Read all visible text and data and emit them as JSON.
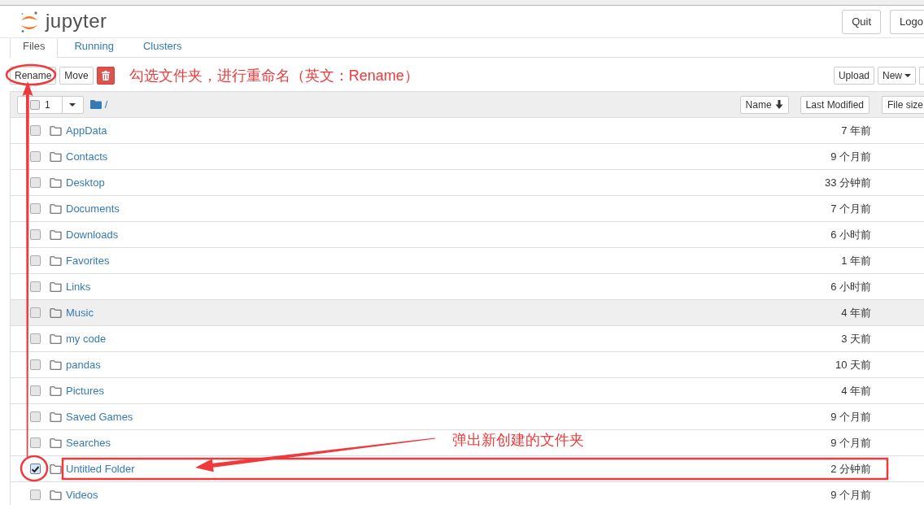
{
  "header": {
    "logo": "jupyter",
    "buttons": [
      "Quit",
      "Logo"
    ]
  },
  "tabs": [
    {
      "label": "Files",
      "selected": true
    },
    {
      "label": "Running",
      "selected": false
    },
    {
      "label": "Clusters",
      "selected": false
    }
  ],
  "toolbar": {
    "left_buttons": [
      "Rename",
      "Move"
    ],
    "note": "勾选文件夹，进行重命名（英文：Rename）",
    "right_buttons": [
      {
        "label": "Upload",
        "dropdown": false
      },
      {
        "label": "New",
        "dropdown": true
      }
    ]
  },
  "list_header": {
    "select_all_checked": false,
    "selected_count": "1",
    "path": "/",
    "sort_buttons": [
      {
        "label": "Name",
        "sorted": true
      },
      {
        "label": "Last Modified",
        "sorted": false
      },
      {
        "label": "File size",
        "sorted": false
      }
    ]
  },
  "files": [
    {
      "name": "AppData",
      "modified": "7 年前",
      "checked": false,
      "highlighted": false
    },
    {
      "name": "Contacts",
      "modified": "9 个月前",
      "checked": false,
      "highlighted": false
    },
    {
      "name": "Desktop",
      "modified": "33 分钟前",
      "checked": false,
      "highlighted": false
    },
    {
      "name": "Documents",
      "modified": "7 个月前",
      "checked": false,
      "highlighted": false
    },
    {
      "name": "Downloads",
      "modified": "6 小时前",
      "checked": false,
      "highlighted": false
    },
    {
      "name": "Favorites",
      "modified": "1 年前",
      "checked": false,
      "highlighted": false
    },
    {
      "name": "Links",
      "modified": "6 小时前",
      "checked": false,
      "highlighted": false
    },
    {
      "name": "Music",
      "modified": "4 年前",
      "checked": false,
      "highlighted": true
    },
    {
      "name": "my code",
      "modified": "3 天前",
      "checked": false,
      "highlighted": false
    },
    {
      "name": "pandas",
      "modified": "10 天前",
      "checked": false,
      "highlighted": false
    },
    {
      "name": "Pictures",
      "modified": "4 年前",
      "checked": false,
      "highlighted": false
    },
    {
      "name": "Saved Games",
      "modified": "9 个月前",
      "checked": false,
      "highlighted": false
    },
    {
      "name": "Searches",
      "modified": "9 个月前",
      "checked": false,
      "highlighted": false
    },
    {
      "name": "Untitled Folder",
      "modified": "2 分钟前",
      "checked": true,
      "highlighted": false
    },
    {
      "name": "Videos",
      "modified": "9 个月前",
      "checked": false,
      "highlighted": false
    }
  ],
  "callout": {
    "text": "弹出新创建的文件夹"
  }
}
